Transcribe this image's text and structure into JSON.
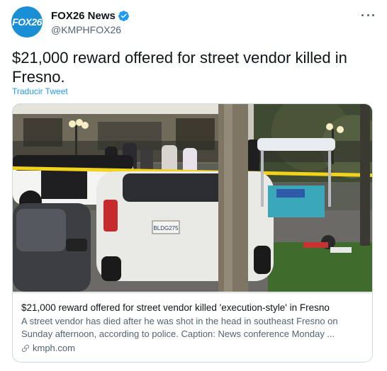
{
  "account": {
    "avatar_text": "FOX26",
    "display_name": "FOX26 News",
    "handle": "@KMPHFOX26",
    "verified": true
  },
  "tweet": {
    "text": "$21,000 reward offered for street vendor killed in Fresno.",
    "translate_label": "Traducir Tweet"
  },
  "link_card": {
    "image_caption": "",
    "title": "$21,000 reward offered for street vendor killed 'execution-style' in Fresno",
    "description": "A street vendor has died after he was shot in the head in southeast Fresno on Sunday afternoon, according to police. Caption: News conference Monday ...",
    "domain": "kmph.com",
    "plate_text": "BLDG275"
  },
  "colors": {
    "accent": "#1d9bf0",
    "avatar_bg": "#1a8fd6",
    "text_primary": "#0f1419",
    "text_secondary": "#536471",
    "border": "#cfd9de"
  },
  "icons": {
    "verified": "verified-badge-icon",
    "more": "more-horizontal-icon",
    "link": "link-icon"
  }
}
